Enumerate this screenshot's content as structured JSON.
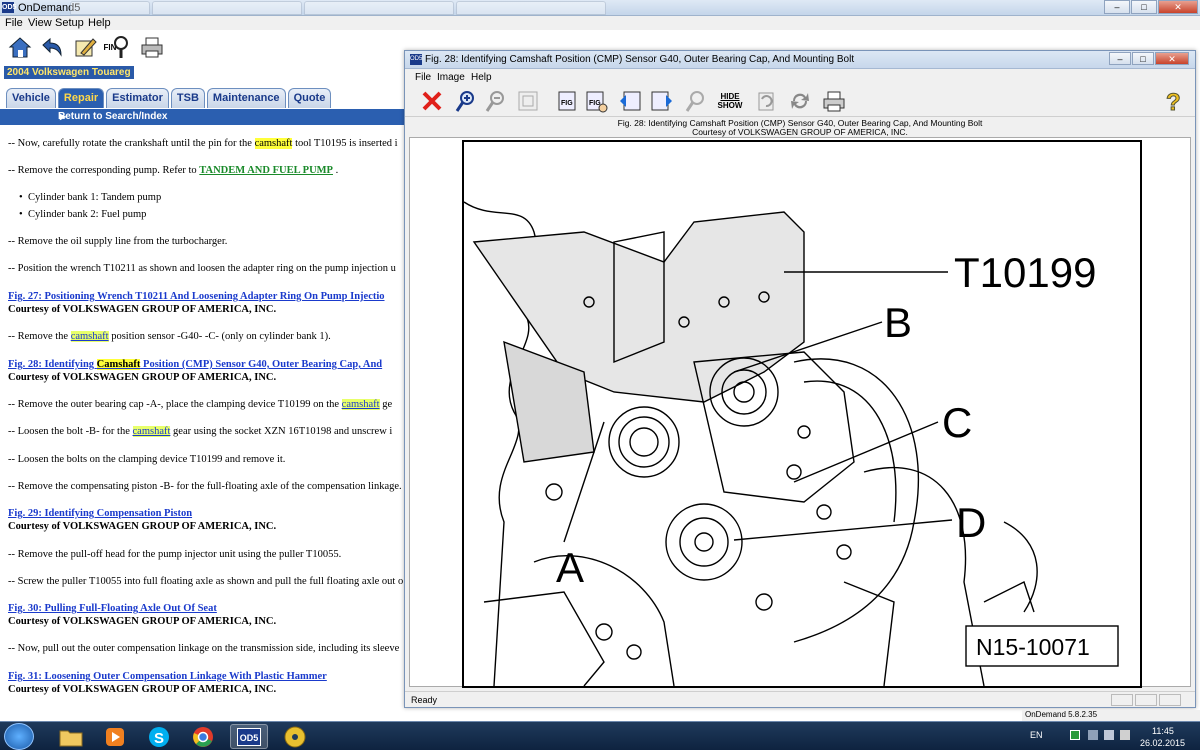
{
  "window": {
    "title": "OnDemand5",
    "app_logo": "OD5"
  },
  "menubar": {
    "items": [
      "File",
      "View",
      "Setup",
      "Help"
    ]
  },
  "toolbar": {
    "icons": [
      "home-icon",
      "back-icon",
      "edit-icon",
      "find-icon",
      "print-icon"
    ],
    "find_label": "FIN"
  },
  "vehicle": {
    "label": "2004 Volkswagen Touareg"
  },
  "tabs": [
    "Vehicle",
    "Repair",
    "Estimator",
    "TSB",
    "Maintenance",
    "Quote"
  ],
  "active_tab": "Repair",
  "return_link": "Return to Search/Index",
  "document": {
    "p1": {
      "a": "-- Now, carefully rotate the crankshaft until the pin for the ",
      "hl": "camshaft",
      "b": " tool T10195 is inserted i"
    },
    "p2": {
      "a": "-- Remove the corresponding pump. Refer to ",
      "link": "TANDEM AND FUEL PUMP",
      "b": " ."
    },
    "bullets": [
      "Cylinder bank 1: Tandem pump",
      "Cylinder bank 2: Fuel pump"
    ],
    "p3": "-- Remove the oil supply line from the turbocharger.",
    "p4": "-- Position the wrench T10211 as shown and loosen the adapter ring on the pump injection u",
    "fig27": "Fig. 27: Positioning Wrench T10211 And Loosening Adapter Ring On Pump Injectio",
    "courtesy": "Courtesy of VOLKSWAGEN GROUP OF AMERICA, INC.",
    "p5": {
      "a": "-- Remove the ",
      "hl": "camshaft",
      "b": " position sensor -G40- -C- (only on cylinder bank 1)."
    },
    "fig28": {
      "a": "Fig. 28: Identifying ",
      "hl": "Camshaft",
      "b": " Position (CMP) Sensor G40, Outer Bearing Cap, And"
    },
    "p6": {
      "a": "-- Remove the outer bearing cap -A-, place the clamping device T10199 on the ",
      "hl": "camshaft",
      "b": " ge"
    },
    "p7": {
      "a": "-- Loosen the bolt -B- for the ",
      "hl": "camshaft",
      "b": " gear using the socket XZN 16T10198 and unscrew i"
    },
    "p8": "-- Loosen the bolts on the clamping device T10199 and remove it.",
    "p9": "-- Remove the compensating piston -B- for the full-floating axle of the compensation linkage.",
    "fig29": "Fig. 29: Identifying Compensation Piston",
    "p10": "-- Remove the pull-off head for the pump injector unit using the puller T10055.",
    "p11": "-- Screw the puller T10055 into full floating axle as shown and pull the full floating axle out o",
    "fig30": "Fig. 30: Pulling Full-Floating Axle Out Of Seat",
    "p12": "-- Now, pull out the outer compensation linkage on the transmission side, including its sleeve",
    "fig31": "Fig. 31: Loosening Outer Compensation Linkage With Plastic Hammer"
  },
  "figure_window": {
    "title": "Fig. 28: Identifying Camshaft Position (CMP) Sensor G40, Outer Bearing Cap, And Mounting Bolt",
    "menu": [
      "File",
      "Image",
      "Help"
    ],
    "toolbar": {
      "fig_label": "FIG",
      "hide": "HIDE",
      "show": "SHOW"
    },
    "caption_line1": "Fig. 28: Identifying Camshaft Position (CMP) Sensor G40, Outer Bearing Cap, And Mounting Bolt",
    "caption_line2": "Courtesy of VOLKSWAGEN GROUP OF AMERICA, INC.",
    "status": "Ready",
    "labels": {
      "tool": "T10199",
      "b": "B",
      "c": "C",
      "d": "D",
      "a": "A",
      "ref": "N15-10071"
    }
  },
  "version": "OnDemand 5.8.2.35",
  "tray": {
    "lang": "EN",
    "time": "11:45",
    "date": "26.02.2015"
  },
  "taskbar": [
    "start-orb-icon",
    "folder-icon",
    "media-player-icon",
    "skype-icon",
    "chrome-icon",
    "od5-icon",
    "disc-icon"
  ],
  "colors": {
    "accent": "#2b5fb0",
    "highlight": "#ffff3a",
    "link": "#1a3acc",
    "close_red": "#e0201a"
  }
}
